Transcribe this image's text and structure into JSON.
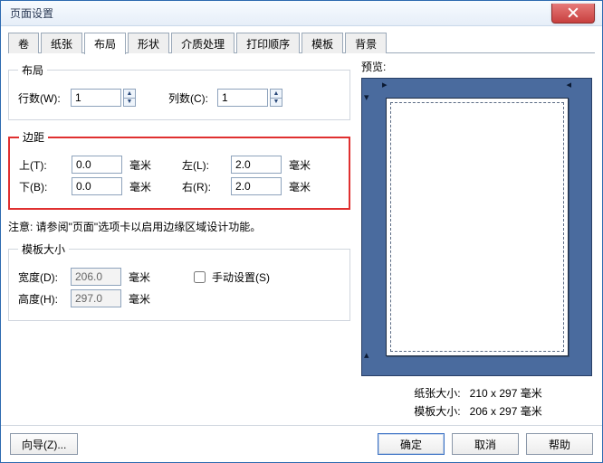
{
  "window": {
    "title": "页面设置"
  },
  "tabs": {
    "items": [
      {
        "label": "卷"
      },
      {
        "label": "纸张"
      },
      {
        "label": "布局"
      },
      {
        "label": "形状"
      },
      {
        "label": "介质处理"
      },
      {
        "label": "打印顺序"
      },
      {
        "label": "模板"
      },
      {
        "label": "背景"
      }
    ],
    "active": 2
  },
  "layout_group": {
    "legend": "布局",
    "rows_label": "行数(W):",
    "rows_value": "1",
    "cols_label": "列数(C):",
    "cols_value": "1"
  },
  "margin_group": {
    "legend": "边距",
    "unit": "毫米",
    "top_label": "上(T):",
    "top_value": "0.0",
    "bottom_label": "下(B):",
    "bottom_value": "0.0",
    "left_label": "左(L):",
    "left_value": "2.0",
    "right_label": "右(R):",
    "right_value": "2.0"
  },
  "note": "注意: 请参阅\"页面\"选项卡以启用边缘区域设计功能。",
  "template_group": {
    "legend": "模板大小",
    "unit": "毫米",
    "width_label": "宽度(D):",
    "width_value": "206.0",
    "height_label": "高度(H):",
    "height_value": "297.0",
    "manual_label": "手动设置(S)",
    "manual_checked": false
  },
  "preview": {
    "label": "预览:",
    "paper_size_label": "纸张大小:",
    "paper_size_value": "210 x 297 毫米",
    "template_size_label": "模板大小:",
    "template_size_value": "206 x 297 毫米"
  },
  "buttons": {
    "wizard": "向导(Z)...",
    "ok": "确定",
    "cancel": "取消",
    "help": "帮助"
  }
}
